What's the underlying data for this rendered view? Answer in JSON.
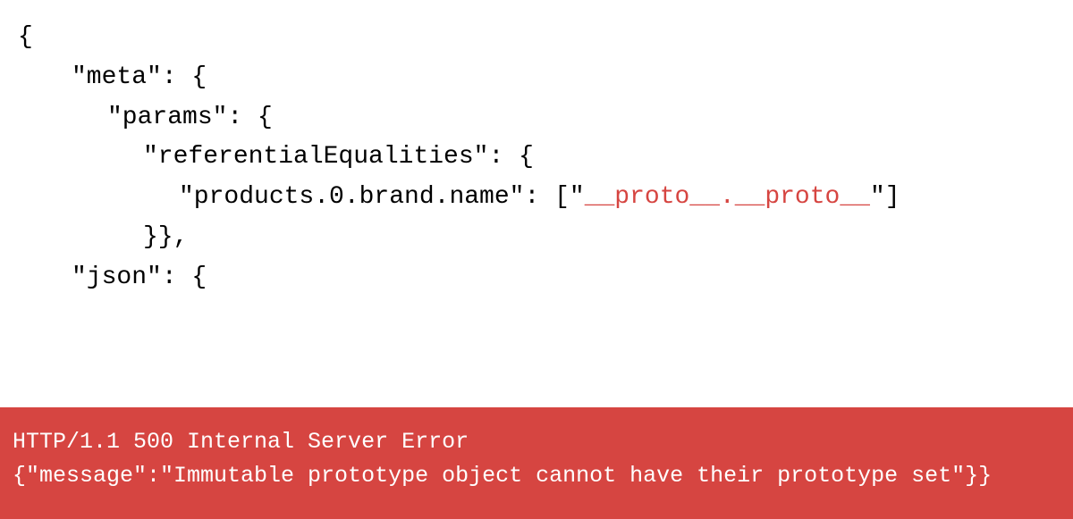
{
  "code": {
    "line1": "{",
    "line2_key": "\"meta\": {",
    "line3_key": "\"params\": {",
    "line4_key": "\"referentialEqualities\": {",
    "line5_key": "\"products.0.brand.name\": [\"",
    "line5_highlight": "__proto__.__proto__",
    "line5_suffix": "\"]",
    "line6": "}},",
    "line7_key": "\"json\": {"
  },
  "error": {
    "status_line": "HTTP/1.1 500 Internal Server Error",
    "body": "{\"message\":\"Immutable prototype object cannot have their prototype set\"}}"
  }
}
